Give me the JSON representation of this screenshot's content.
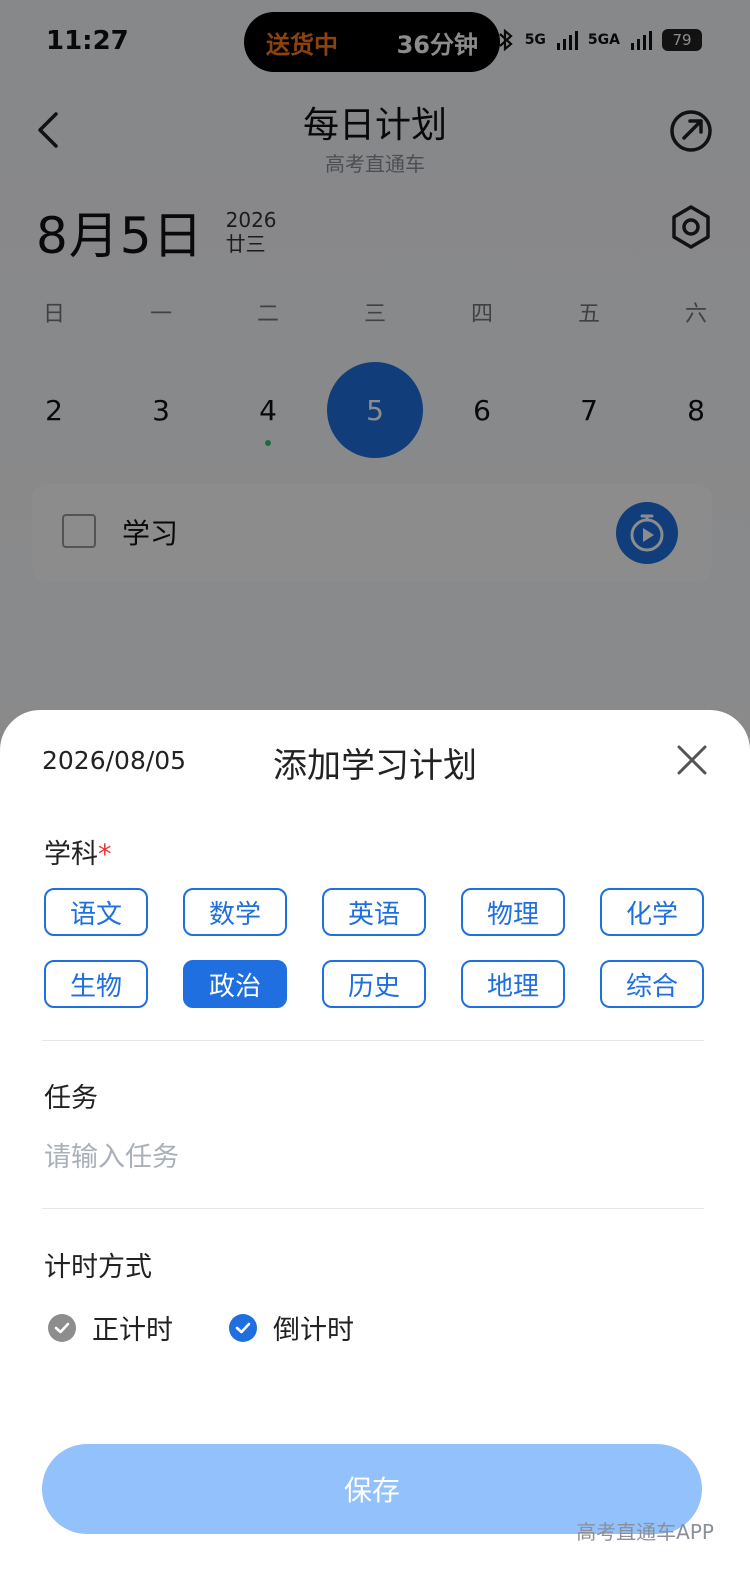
{
  "status": {
    "time": "11:27",
    "island_left": "送货中",
    "island_right": "36分钟",
    "signal1": "5G",
    "signal2": "5GA",
    "battery": "79"
  },
  "nav": {
    "title": "每日计划",
    "subtitle": "高考直通车"
  },
  "date": {
    "big": "8月5日",
    "year": "2026",
    "lunar": "廿三"
  },
  "week": {
    "days": [
      "日",
      "一",
      "二",
      "三",
      "四",
      "五",
      "六"
    ],
    "dates": [
      "2",
      "3",
      "4",
      "5",
      "6",
      "7",
      "8"
    ]
  },
  "task_card": {
    "label": "学习"
  },
  "sheet": {
    "date": "2026/08/05",
    "title": "添加学习计划",
    "subject_label": "学科",
    "required_mark": "*",
    "subjects": [
      "语文",
      "数学",
      "英语",
      "物理",
      "化学",
      "生物",
      "政治",
      "历史",
      "地理",
      "综合"
    ],
    "selected_subject": "政治",
    "task_label": "任务",
    "task_placeholder": "请输入任务",
    "timing_label": "计时方式",
    "timing_options": [
      "正计时",
      "倒计时"
    ],
    "save_label": "保存",
    "watermark": "高考直通车APP"
  },
  "colors": {
    "accent": "#1f6fe0",
    "save_disabled": "#93c1fb",
    "dot": "#37c17f",
    "required": "#e53935"
  }
}
